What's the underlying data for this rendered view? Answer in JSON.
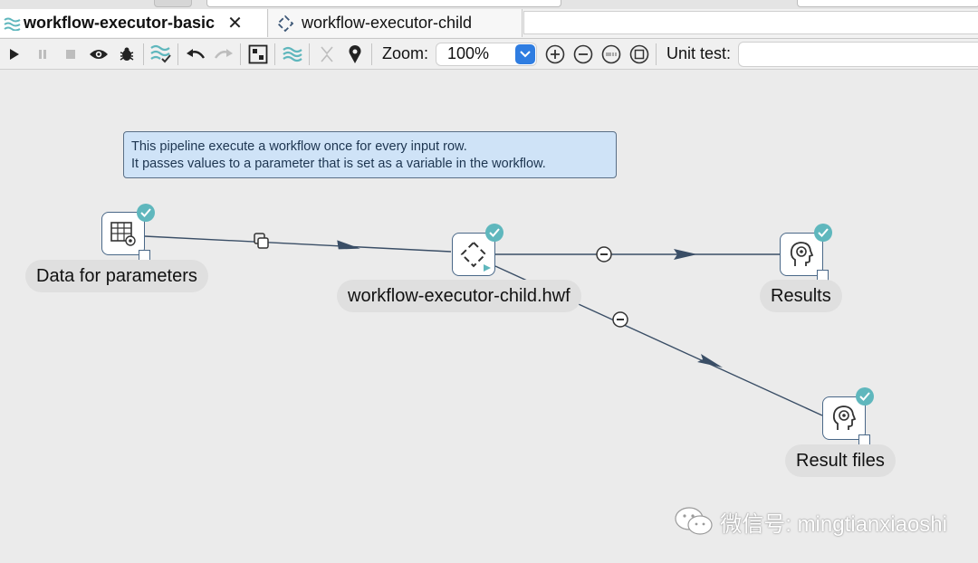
{
  "tabs": [
    {
      "label": "workflow-executor-basic",
      "icon": "pipeline-waves-icon",
      "active": true,
      "closable": true
    },
    {
      "label": "workflow-executor-child",
      "icon": "workflow-diamond-icon",
      "active": false
    }
  ],
  "toolbar": {
    "buttons": [
      "run-icon",
      "pause-icon",
      "stop-icon",
      "preview-icon",
      "debug-icon",
      "check-pipeline-icon",
      "undo-icon",
      "redo-icon",
      "align-icon",
      "dataflow-icon",
      "shuffle-icon",
      "location-pin-icon"
    ],
    "zoom_label": "Zoom:",
    "zoom_value": "100%",
    "unit_test_label": "Unit test:",
    "unit_test_value": ""
  },
  "note": {
    "line1": "This pipeline execute a workflow once for every input row.",
    "line2": "It passes values to a parameter that is set as a variable in the workflow."
  },
  "nodes": [
    {
      "id": "data",
      "label": "Data for parameters",
      "icon": "data-grid-icon"
    },
    {
      "id": "wf",
      "label": "workflow-executor-child.hwf",
      "icon": "workflow-executor-icon"
    },
    {
      "id": "results",
      "label": "Results",
      "icon": "head-gear-icon"
    },
    {
      "id": "resultfiles",
      "label": "Result files",
      "icon": "head-gear-icon"
    }
  ],
  "hops": [
    {
      "from": "data",
      "to": "wf",
      "type": "copy"
    },
    {
      "from": "wf",
      "to": "results",
      "type": "result"
    },
    {
      "from": "wf",
      "to": "resultfiles",
      "type": "result"
    }
  ],
  "colors": {
    "accent": "#2f7de1",
    "badge": "#5fb7bd",
    "node_border": "#4a6888",
    "note_bg": "#cfe3f7",
    "hop": "#3a4e66"
  },
  "watermark": "微信号: mingtianxiaoshi"
}
